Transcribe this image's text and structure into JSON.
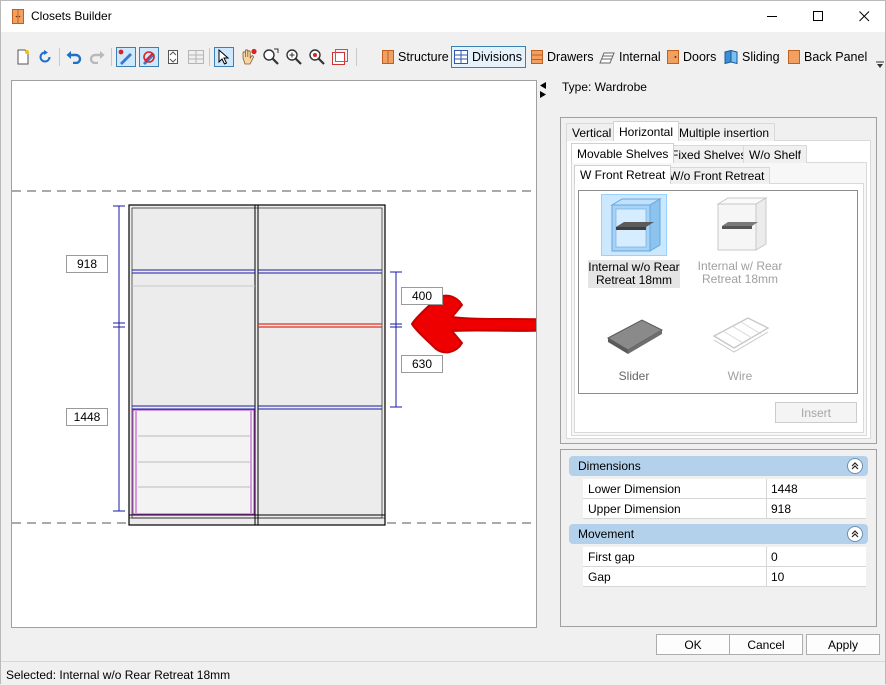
{
  "window": {
    "title": "Closets Builder"
  },
  "toolbar": {
    "buttons": {
      "structure": "Structure",
      "divisions": "Divisions",
      "drawers": "Drawers",
      "internal": "Internal",
      "doors": "Doors",
      "sliding": "Sliding",
      "back_panel": "Back Panel"
    }
  },
  "canvas": {
    "dimensions": {
      "upper_left": "918",
      "lower_left": "1448",
      "upper_right": "400",
      "lower_right": "630"
    }
  },
  "type_info": "Type: Wardrobe",
  "tabs": {
    "level1": [
      "Vertical",
      "Horizontal",
      "Multiple insertion"
    ],
    "level2": [
      "Movable Shelves",
      "Fixed Shelves",
      "W/o Shelf"
    ],
    "level3": [
      "W Front Retreat",
      "W/o Front Retreat"
    ]
  },
  "items": [
    {
      "label": "Internal w/o Rear Retreat 18mm",
      "line1": "Internal w/o Rear",
      "line2": "Retreat 18mm",
      "icon": "internal-shelf-icon",
      "selected": true
    },
    {
      "label": "Internal w/ Rear Retreat 18mm",
      "line1": "Internal w/ Rear",
      "line2": "Retreat 18mm",
      "icon": "internal-shelf-rear-icon",
      "disabled": true
    },
    {
      "label": "Slider",
      "line1": "Slider",
      "line2": "",
      "icon": "slider-shelf-icon"
    },
    {
      "label": "Wire",
      "line1": "Wire",
      "line2": "",
      "icon": "wire-shelf-icon",
      "disabled": true
    }
  ],
  "insert_label": "Insert",
  "properties": {
    "dimensions": {
      "header": "Dimensions",
      "rows": [
        {
          "name": "Lower Dimension",
          "value": "1448"
        },
        {
          "name": "Upper Dimension",
          "value": "918"
        }
      ]
    },
    "movement": {
      "header": "Movement",
      "rows": [
        {
          "name": "First gap",
          "value": "0"
        },
        {
          "name": "Gap",
          "value": "10"
        }
      ]
    }
  },
  "buttons": {
    "ok": "OK",
    "cancel": "Cancel",
    "apply": "Apply"
  },
  "status": "Selected: Internal w/o Rear Retreat 18mm",
  "colors": {
    "accent": "#3c7fb1",
    "selection": "#cce8ff",
    "category_header": "#b4d1ec",
    "division_blue": "#1a1aa6",
    "selected_shelf_red": "#e0301e",
    "drawer_purple": "#b43cc8",
    "arrow_red": "#ee0000"
  }
}
